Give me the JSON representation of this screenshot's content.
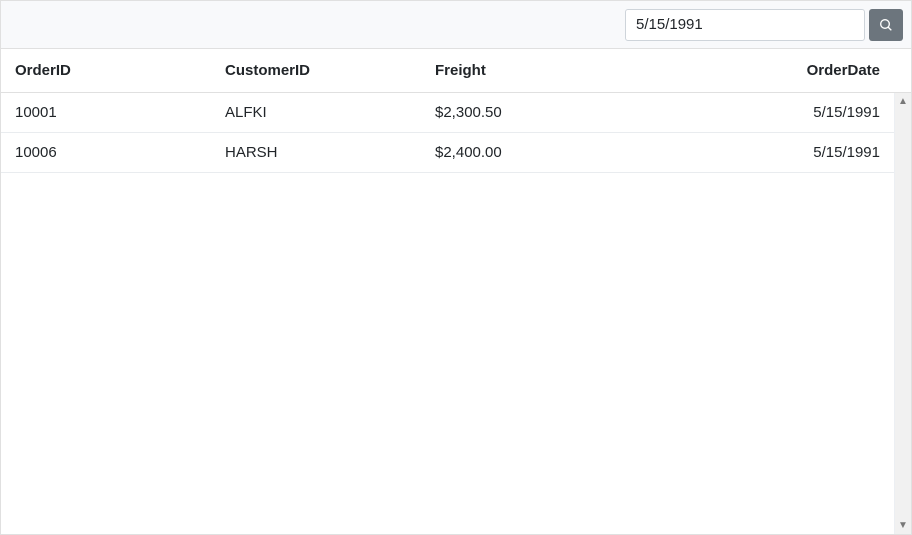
{
  "search": {
    "value": "5/15/1991",
    "placeholder": ""
  },
  "columns": {
    "orderId": "OrderID",
    "customerId": "CustomerID",
    "freight": "Freight",
    "orderDate": "OrderDate"
  },
  "rows": [
    {
      "orderId": "10001",
      "customerId": "ALFKI",
      "freight": "$2,300.50",
      "orderDate": "5/15/1991"
    },
    {
      "orderId": "10006",
      "customerId": "HARSH",
      "freight": "$2,400.00",
      "orderDate": "5/15/1991"
    }
  ]
}
